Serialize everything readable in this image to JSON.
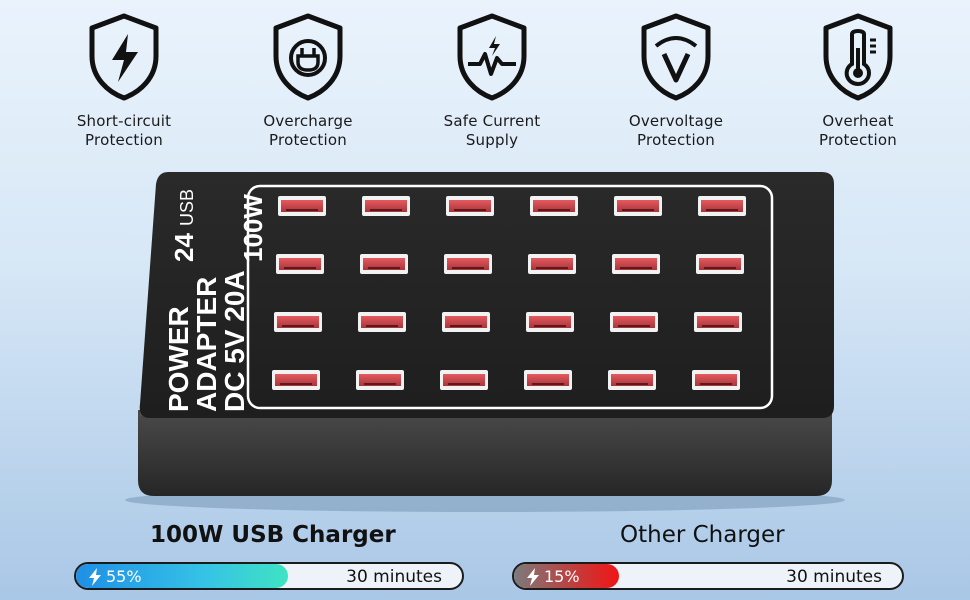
{
  "features": [
    {
      "icon": "lightning-shield-icon",
      "label": "Short-circuit\nProtection"
    },
    {
      "icon": "plug-shield-icon",
      "label": "Overcharge\nProtection"
    },
    {
      "icon": "pulse-shield-icon",
      "label": "Safe Current\nSupply"
    },
    {
      "icon": "volt-meter-shield-icon",
      "label": "Overvoltage\nProtection"
    },
    {
      "icon": "thermometer-shield-icon",
      "label": "Overheat\nProtection"
    }
  ],
  "device": {
    "port_count_label": "24",
    "usb_label": "USB",
    "wattage_label": "100W",
    "power_label": "POWER",
    "adapter_label": "ADAPTER",
    "spec_label": "DC 5V 20A",
    "port_rows": 4,
    "port_cols": 6
  },
  "comparison": {
    "left": {
      "title": "100W USB Charger",
      "percent_label": "55%",
      "percent": 55,
      "time": "30 minutes"
    },
    "right": {
      "title": "Other Charger",
      "percent_label": "15%",
      "percent": 15,
      "time": "30 minutes"
    }
  },
  "colors": {
    "port_red": "#c9484c",
    "device_body": "#2b2b2b",
    "fill_blue": "#2fb6e6",
    "fill_red": "#e82020"
  }
}
